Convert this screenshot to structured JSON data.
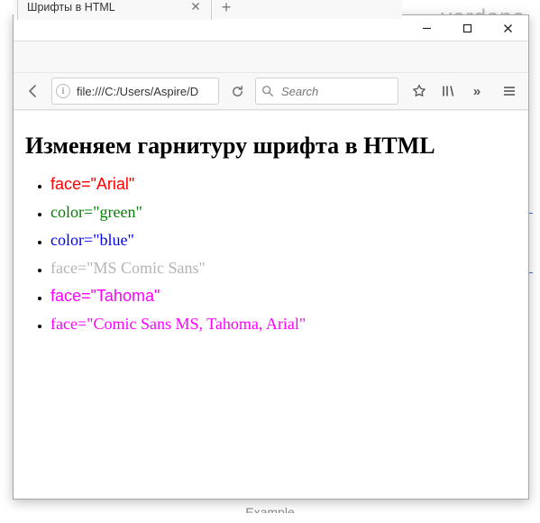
{
  "behind": {
    "top_text": "verdana",
    "bottom_text": "Example"
  },
  "window": {
    "controls": {
      "minimize": "–",
      "maximize": "□",
      "close": "✕"
    }
  },
  "tab": {
    "title": "Шрифты в HTML",
    "close": "✕",
    "newtab": "+"
  },
  "toolbar": {
    "url": "file:///C:/Users/Aspire/D",
    "search_placeholder": "Search",
    "icons": {
      "back": "arrow-left-icon",
      "info": "i",
      "reload": "reload-icon",
      "search": "search-icon",
      "bookmark_star": "star-icon",
      "library": "library-icon",
      "overflow": "»",
      "menu": "menu-icon"
    }
  },
  "page": {
    "heading": "Изменяем гарнитуру шрифта в HTML",
    "items": [
      {
        "text": "face=\"Arial\"",
        "class": "li0"
      },
      {
        "text": "color=\"green\"",
        "class": "li1"
      },
      {
        "text": "color=\"blue\"",
        "class": "li2"
      },
      {
        "text": "face=\"MS Comic Sans\"",
        "class": "li3"
      },
      {
        "text": "face=\"Tahoma\"",
        "class": "li4"
      },
      {
        "text": "face=\"Comic Sans MS, Tahoma, Arial\"",
        "class": "li5"
      }
    ]
  }
}
